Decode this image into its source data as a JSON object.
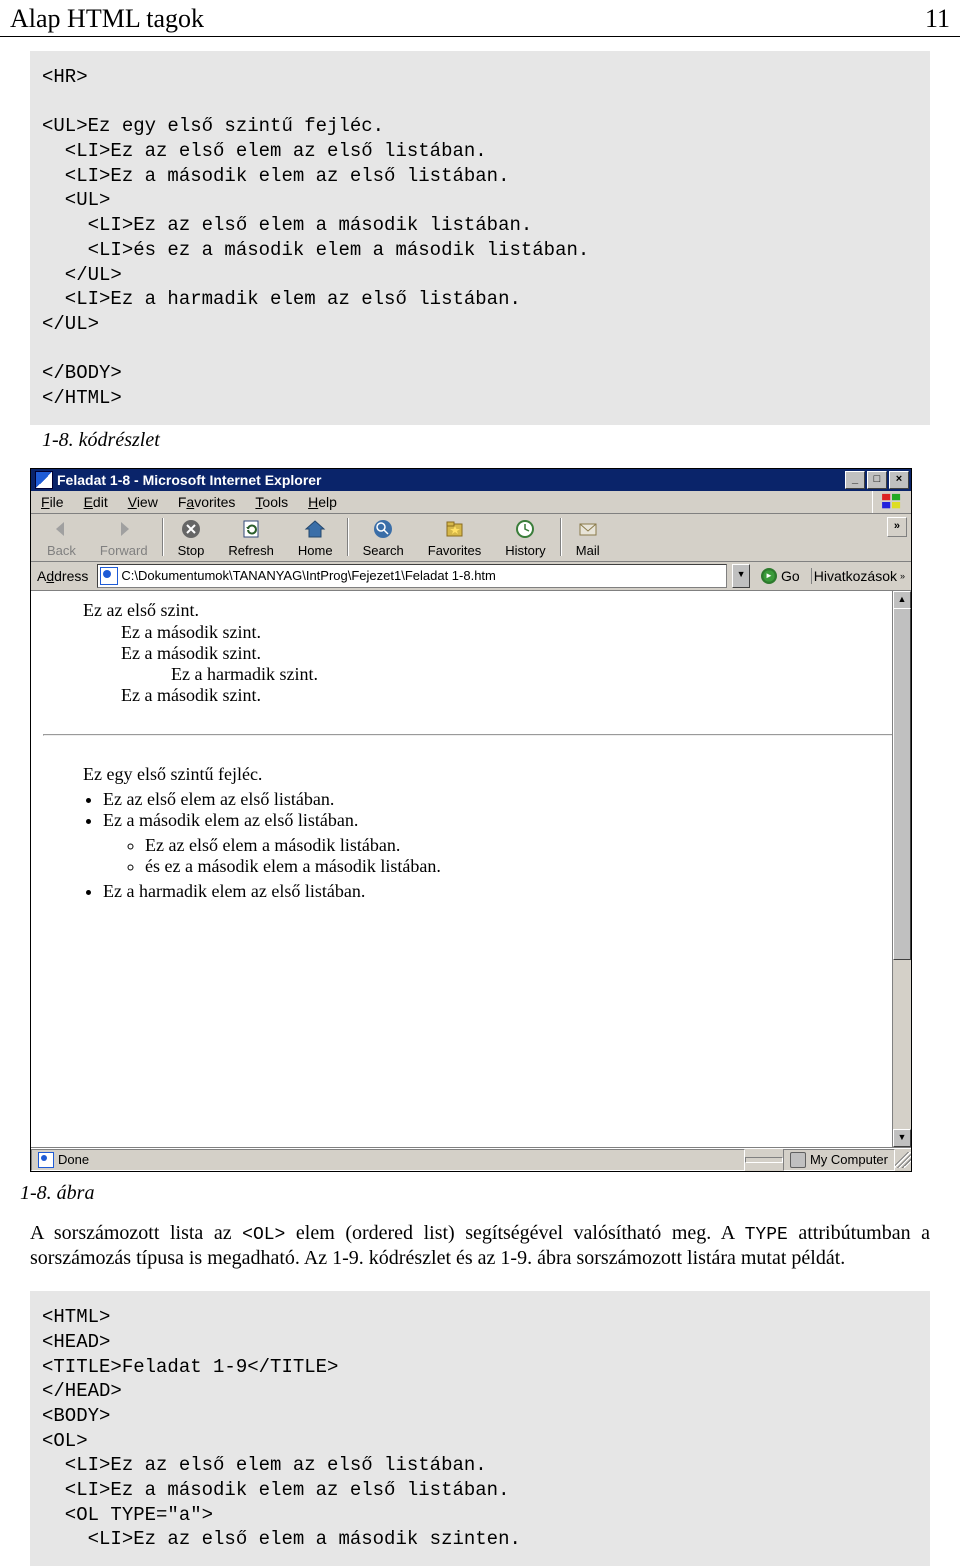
{
  "header": {
    "title": "Alap HTML tagok",
    "page": "11"
  },
  "code1": {
    "lines": [
      "<HR>",
      "",
      "<UL>Ez egy első szintű fejléc.",
      "  <LI>Ez az első elem az első listában.",
      "  <LI>Ez a második elem az első listában.",
      "  <UL>",
      "    <LI>Ez az első elem a második listában.",
      "    <LI>és ez a második elem a második listában.",
      "  </UL>",
      "  <LI>Ez a harmadik elem az első listában.",
      "</UL>",
      "",
      "</BODY>",
      "</HTML>"
    ]
  },
  "caption1": "1-8. kódrészlet",
  "browser": {
    "title": "Feladat 1-8 - Microsoft Internet Explorer",
    "menu": {
      "file": "File",
      "edit": "Edit",
      "view": "View",
      "fav": "Favorites",
      "tools": "Tools",
      "help": "Help"
    },
    "toolbar": {
      "back": "Back",
      "forward": "Forward",
      "stop": "Stop",
      "refresh": "Refresh",
      "home": "Home",
      "search": "Search",
      "favorites": "Favorites",
      "history": "History",
      "mail": "Mail"
    },
    "addressLabel": "Address",
    "addressPath": "C:\\Dokumentumok\\TANANYAG\\IntProg\\Fejezet1\\Feladat 1-8.htm",
    "go": "Go",
    "links": "Hivatkozások",
    "content": {
      "l1": "Ez az első szint.",
      "l2a": "Ez a második szint.",
      "l2b": "Ez a második szint.",
      "l3": "Ez a harmadik szint.",
      "l2c": "Ez a második szint.",
      "header2": "Ez egy első szintű fejléc.",
      "li1": "Ez az első elem az első listában.",
      "li2": "Ez a második elem az első listában.",
      "li2_1": "Ez az első elem a második listában.",
      "li2_2": "és ez a második elem a második listában.",
      "li3": "Ez a harmadik elem az első listában."
    },
    "status": {
      "done": "Done",
      "zone": "My Computer"
    }
  },
  "caption2": "1-8. ábra",
  "para": {
    "t1": "A sorszámozott lista az ",
    "c1": "<OL>",
    "t2": " elem (ordered list) segítségével valósítható meg. A ",
    "c2": "TYPE",
    "t3": " attribútumban a sorszámozás típusa is megadható. Az 1-9. kódrészlet és az 1-9. ábra sorszámozott listára mutat példát."
  },
  "code2": {
    "lines": [
      "<HTML>",
      "<HEAD>",
      "<TITLE>Feladat 1-9</TITLE>",
      "</HEAD>",
      "<BODY>",
      "<OL>",
      "  <LI>Ez az első elem az első listában.",
      "  <LI>Ez a második elem az első listában.",
      "  <OL TYPE=\"a\">",
      "    <LI>Ez az első elem a második szinten."
    ]
  }
}
